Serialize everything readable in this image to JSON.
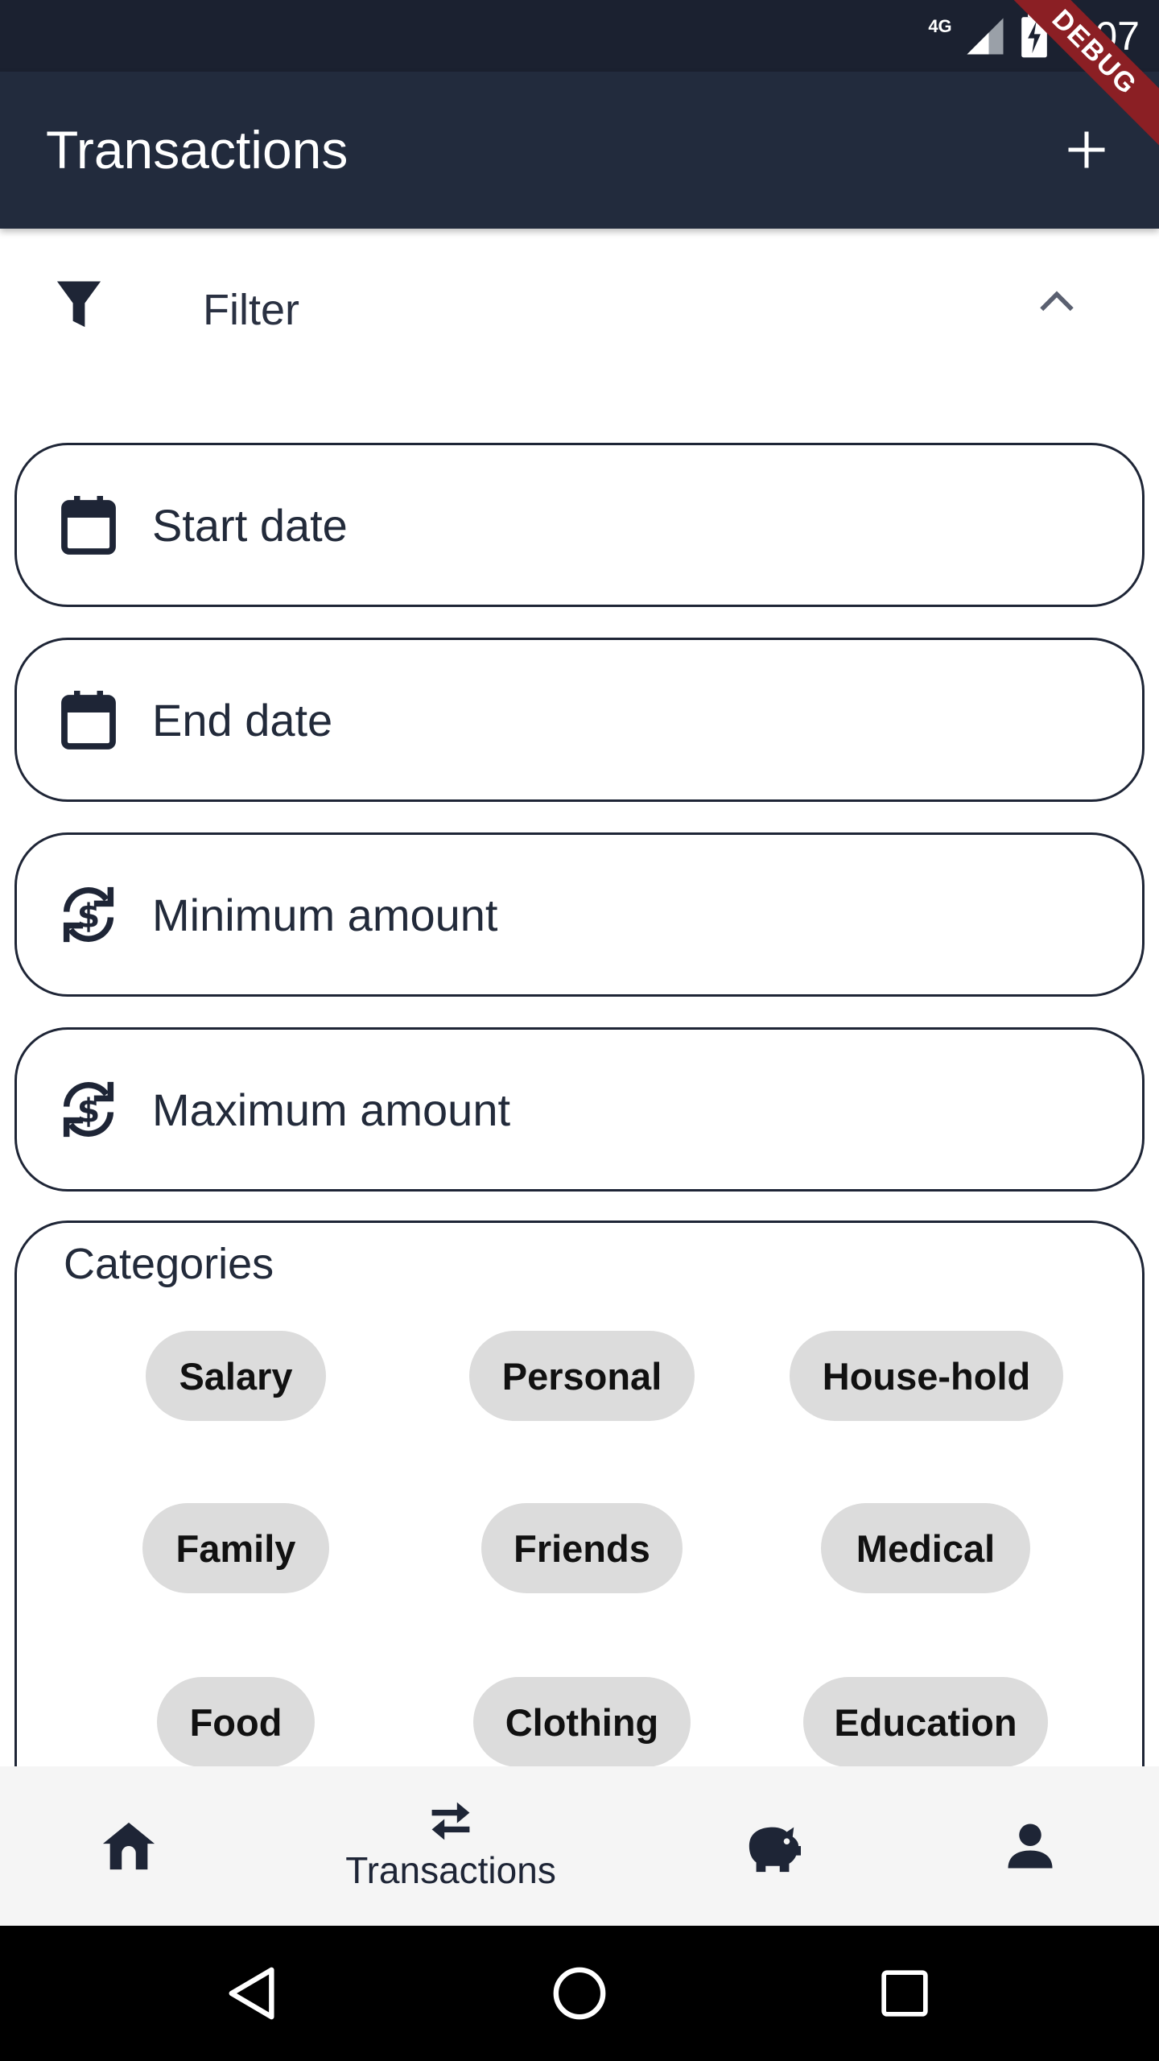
{
  "status_bar": {
    "network": "4G",
    "time": "7:07",
    "debug_label": "DEBUG"
  },
  "app_bar": {
    "title": "Transactions",
    "add_icon": "plus-icon"
  },
  "filter": {
    "label": "Filter",
    "icon": "filter-icon",
    "expanded": true
  },
  "fields": {
    "start_date": {
      "placeholder": "Start date",
      "icon": "calendar-icon"
    },
    "end_date": {
      "placeholder": "End date",
      "icon": "calendar-icon"
    },
    "min_amount": {
      "placeholder": "Minimum amount",
      "icon": "currency-exchange-icon"
    },
    "max_amount": {
      "placeholder": "Maximum amount",
      "icon": "currency-exchange-icon"
    }
  },
  "categories": {
    "label": "Categories",
    "chips": [
      "Salary",
      "Personal",
      "House-hold",
      "Family",
      "Friends",
      "Medical",
      "Food",
      "Clothing",
      "Education"
    ]
  },
  "bottom_nav": {
    "items": [
      {
        "icon": "home-icon",
        "label": ""
      },
      {
        "icon": "swap-arrows-icon",
        "label": "Transactions"
      },
      {
        "icon": "piggy-bank-icon",
        "label": ""
      },
      {
        "icon": "person-icon",
        "label": ""
      }
    ],
    "selected": 1
  },
  "system_nav": {
    "back": "back-triangle-icon",
    "home": "home-circle-icon",
    "recents": "recents-square-icon"
  },
  "colors": {
    "app_bar": "#222b3d",
    "status_bar": "#1b2130",
    "chip_bg": "#dcdcdc",
    "outline": "#1e2536",
    "debug": "#8b1f24"
  }
}
